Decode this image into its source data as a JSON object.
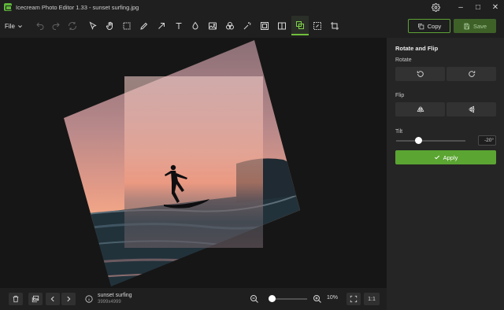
{
  "window": {
    "title": "Icecream Photo Editor 1.33 - sunset surfing.jpg",
    "minimize": "–",
    "maximize": "□",
    "close": "✕"
  },
  "toolbar": {
    "file_label": "File",
    "tools": [
      {
        "name": "undo-icon",
        "enabled": false
      },
      {
        "name": "redo-icon",
        "enabled": false
      },
      {
        "name": "reset-icon",
        "enabled": false
      },
      {
        "name": "pointer-icon",
        "enabled": true
      },
      {
        "name": "hand-icon",
        "enabled": true
      },
      {
        "name": "selection-icon",
        "enabled": true
      },
      {
        "name": "pencil-icon",
        "enabled": true
      },
      {
        "name": "arrow-icon",
        "enabled": true
      },
      {
        "name": "text-icon",
        "enabled": true
      },
      {
        "name": "blur-icon",
        "enabled": true
      },
      {
        "name": "image-icon",
        "enabled": true
      },
      {
        "name": "filters-icon",
        "enabled": true
      },
      {
        "name": "magic-wand-icon",
        "enabled": true
      },
      {
        "name": "frame-icon",
        "enabled": true
      },
      {
        "name": "split-icon",
        "enabled": true
      },
      {
        "name": "rotate-flip-icon",
        "enabled": true,
        "active": true
      },
      {
        "name": "resize-icon",
        "enabled": true
      },
      {
        "name": "crop-icon",
        "enabled": true
      }
    ],
    "copy_label": "Copy",
    "save_label": "Save"
  },
  "panel": {
    "title": "Rotate and Flip",
    "rotate_label": "Rotate",
    "flip_label": "Flip",
    "tilt_label": "Tilt",
    "tilt_value": "-20°",
    "tilt_min": -45,
    "tilt_max": 45,
    "apply_label": "Apply"
  },
  "bottom": {
    "file_name": "sunset surfing",
    "file_dims": "3999x4999",
    "zoom_level": "10%",
    "one_to_one": "1:1"
  },
  "colors": {
    "accent": "#5ba532",
    "background": "#1e1e1e",
    "panel": "#252525"
  }
}
